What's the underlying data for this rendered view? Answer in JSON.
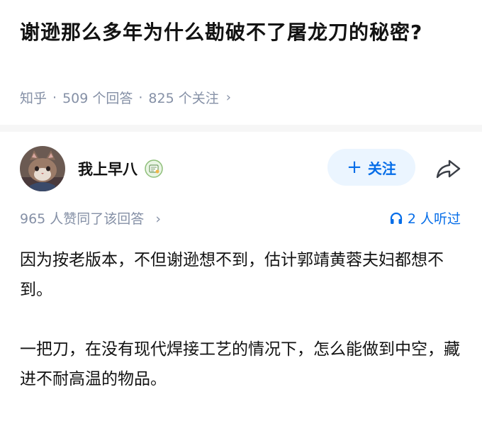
{
  "question": {
    "title": "谢逊那么多年为什么勘破不了屠龙刀的秘密?"
  },
  "meta": {
    "source": "知乎",
    "separator": "·",
    "answers": "509 个回答",
    "followers": "825 个关注",
    "chevron": "›"
  },
  "author": {
    "name": "我上早八",
    "avatar_icon": "cat-avatar-icon",
    "badge_icon": "certified-badge-icon"
  },
  "follow": {
    "plus": "+",
    "label": "关注"
  },
  "share": {
    "icon": "share-icon"
  },
  "approve": {
    "text": "965 人赞同了该回答",
    "chevron": "›"
  },
  "listen": {
    "icon": "headphones-icon",
    "text": "2 人听过"
  },
  "answer": {
    "paragraphs": [
      "因为按老版本，不但谢逊想不到，估计郭靖黄蓉夫妇都想不到。",
      "一把刀，在没有现代焊接工艺的情况下，怎么能做到中空，藏进不耐高温的物品。"
    ]
  },
  "colors": {
    "brand_blue": "#056de8",
    "follow_bg": "#ebf5ff",
    "meta_gray": "#8590a6",
    "text": "#121212"
  }
}
